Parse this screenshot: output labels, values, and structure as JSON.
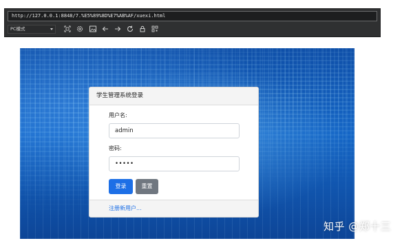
{
  "browser": {
    "url": "http://127.0.0.1:8848/7.%E5%89%8D%E7%AB%AF/xuexi.html",
    "mode": "PC模式",
    "toolbar_icons": [
      "screenshot-icon",
      "settings-icon",
      "image-icon",
      "back-arrow-icon",
      "forward-arrow-icon",
      "refresh-icon",
      "lock-icon",
      "qr-code-icon"
    ]
  },
  "login": {
    "title": "学生管理系统登录",
    "username_label": "用户名:",
    "username_value": "admin",
    "password_label": "密码:",
    "password_value": "•••••",
    "login_button": "登录",
    "reset_button": "重置",
    "register_link": "注册新用户..."
  },
  "watermark": "知乎 @郑十三",
  "colors": {
    "primary": "#1d6fe6",
    "secondary": "#707780",
    "chrome": "#2f3031",
    "background": "#1566c6"
  }
}
